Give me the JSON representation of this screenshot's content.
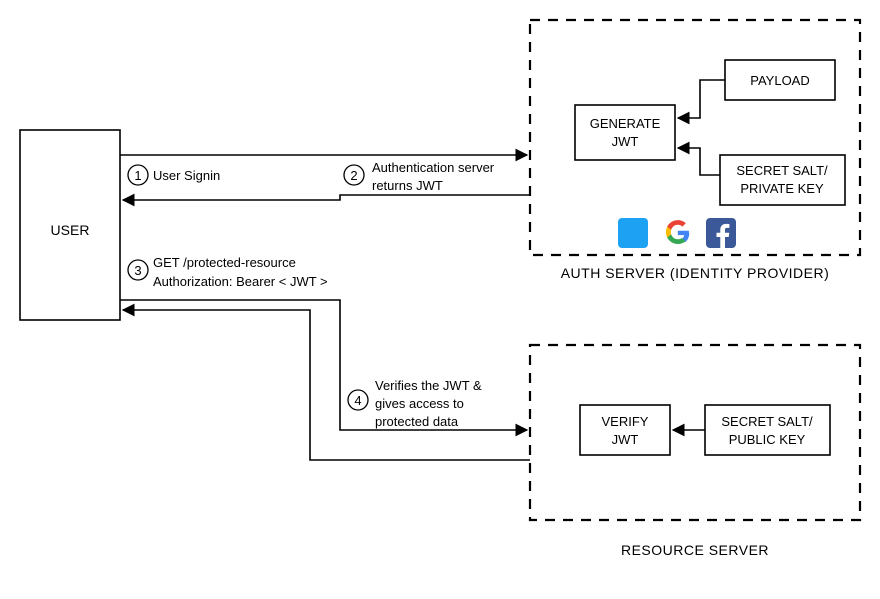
{
  "user_box": {
    "label": "USER"
  },
  "auth_server": {
    "caption": "AUTH SERVER (IDENTITY PROVIDER)",
    "generate": {
      "l1": "GENERATE",
      "l2": "JWT"
    },
    "payload": "PAYLOAD",
    "secret": {
      "l1": "SECRET SALT/",
      "l2": "PRIVATE KEY"
    },
    "icons": {
      "twitter": "twitter-icon",
      "google": "google-icon",
      "facebook": "facebook-icon"
    }
  },
  "resource_server": {
    "caption": "RESOURCE SERVER",
    "verify": {
      "l1": "VERIFY",
      "l2": "JWT"
    },
    "secret": {
      "l1": "SECRET SALT/",
      "l2": "PUBLIC KEY"
    }
  },
  "steps": {
    "s1": {
      "num": "1",
      "text": "User Signin"
    },
    "s2": {
      "num": "2",
      "l1": "Authentication server",
      "l2": "returns JWT"
    },
    "s3": {
      "num": "3",
      "l1": "GET /protected-resource",
      "l2": "Authorization: Bearer  < JWT >"
    },
    "s4": {
      "num": "4",
      "l1": "Verifies the JWT &",
      "l2": "gives access to",
      "l3": "protected data"
    }
  }
}
